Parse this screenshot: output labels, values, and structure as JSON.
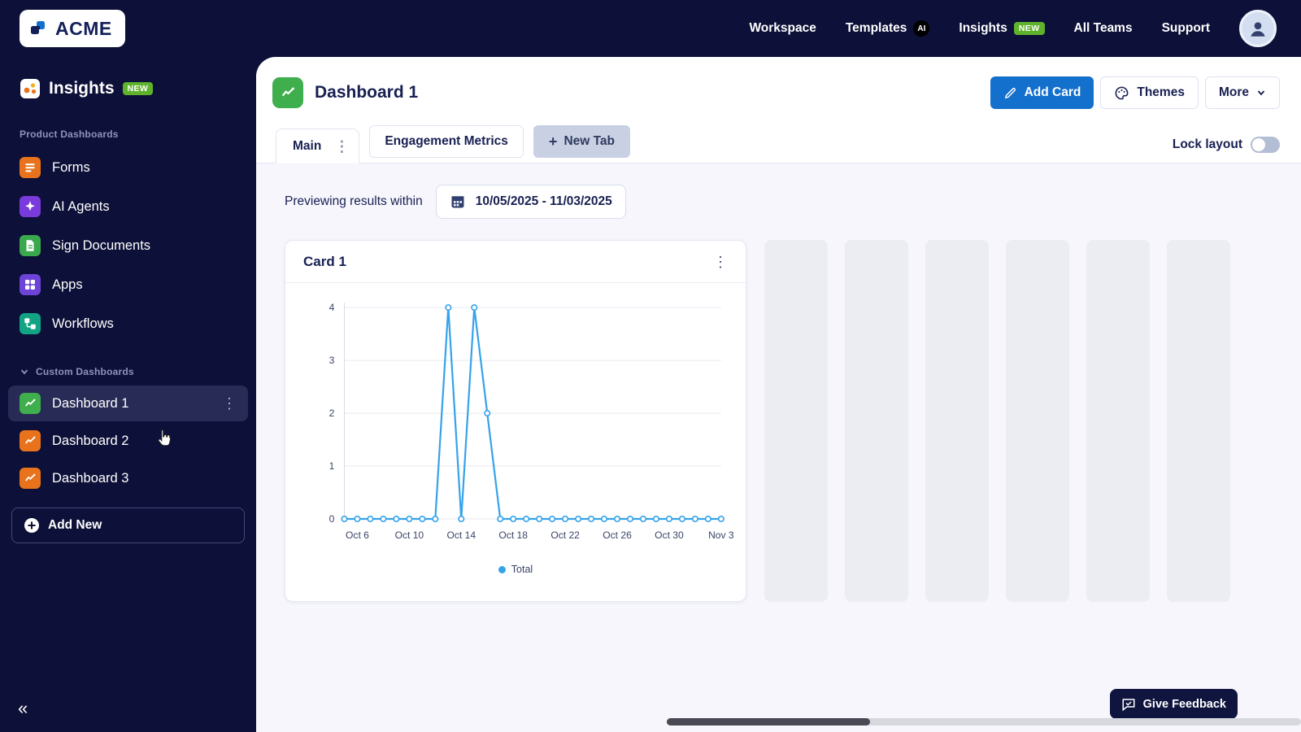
{
  "topnav": {
    "brand": "ACME",
    "items": [
      {
        "label": "Workspace"
      },
      {
        "label": "Templates",
        "badge": "AI"
      },
      {
        "label": "Insights",
        "badge": "NEW"
      },
      {
        "label": "All Teams"
      },
      {
        "label": "Support"
      }
    ]
  },
  "sidebar": {
    "app_title": "Insights",
    "app_badge": "NEW",
    "section_product": "Product Dashboards",
    "items": [
      {
        "label": "Forms"
      },
      {
        "label": "AI Agents"
      },
      {
        "label": "Sign Documents"
      },
      {
        "label": "Apps"
      },
      {
        "label": "Workflows"
      }
    ],
    "section_custom": "Custom Dashboards",
    "dashboards": [
      {
        "label": "Dashboard 1"
      },
      {
        "label": "Dashboard 2"
      },
      {
        "label": "Dashboard 3"
      }
    ],
    "add_new_label": "Add New"
  },
  "main": {
    "page_title": "Dashboard 1",
    "add_card_label": "Add Card",
    "themes_label": "Themes",
    "more_label": "More",
    "tabs": [
      {
        "label": "Main"
      },
      {
        "label": "Engagement Metrics"
      },
      {
        "label": "New Tab"
      }
    ],
    "lock_layout_label": "Lock layout",
    "preview_label": "Previewing results within",
    "date_range": "10/05/2025 - 11/03/2025",
    "card_title": "Card 1"
  },
  "feedback_label": "Give Feedback",
  "chart_data": {
    "type": "line",
    "title": "Card 1",
    "x": [
      "Oct 5",
      "Oct 6",
      "Oct 7",
      "Oct 8",
      "Oct 9",
      "Oct 10",
      "Oct 11",
      "Oct 12",
      "Oct 13",
      "Oct 14",
      "Oct 15",
      "Oct 16",
      "Oct 17",
      "Oct 18",
      "Oct 19",
      "Oct 20",
      "Oct 21",
      "Oct 22",
      "Oct 23",
      "Oct 24",
      "Oct 25",
      "Oct 26",
      "Oct 27",
      "Oct 28",
      "Oct 29",
      "Oct 30",
      "Oct 31",
      "Nov 1",
      "Nov 2",
      "Nov 3"
    ],
    "series": [
      {
        "name": "Total",
        "values": [
          0,
          0,
          0,
          0,
          0,
          0,
          0,
          0,
          4,
          0,
          4,
          2,
          0,
          0,
          0,
          0,
          0,
          0,
          0,
          0,
          0,
          0,
          0,
          0,
          0,
          0,
          0,
          0,
          0,
          0
        ]
      }
    ],
    "ylim": [
      0,
      4
    ],
    "yticks": [
      0,
      1,
      2,
      3,
      4
    ],
    "xtick_labels": [
      "Oct 6",
      "Oct 10",
      "Oct 14",
      "Oct 18",
      "Oct 22",
      "Oct 26",
      "Oct 30",
      "Nov 3"
    ],
    "grid": true,
    "legend_position": "bottom",
    "line_color": "#36a3e9"
  },
  "colors": {
    "accent_blue": "#1470cd",
    "badge_green": "#5fb32c",
    "chart_blue": "#36a3e9"
  }
}
